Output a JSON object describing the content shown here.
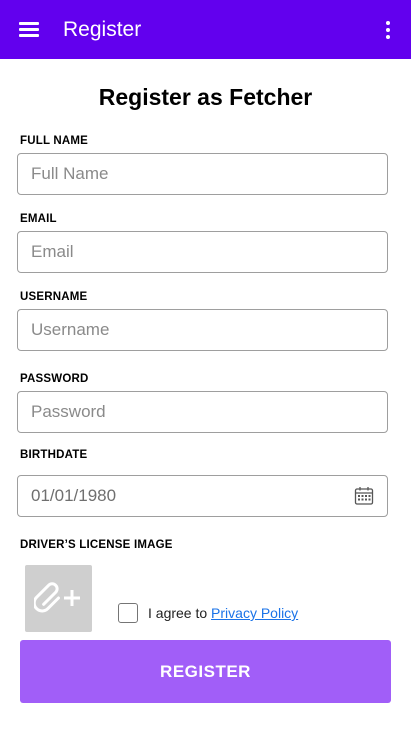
{
  "appbar": {
    "title": "Register",
    "menu_icon": "hamburger-menu-icon",
    "overflow_icon": "more-vert-icon",
    "color": "#6200ee"
  },
  "form": {
    "heading": "Register as Fetcher",
    "full_name": {
      "label": "FULL NAME",
      "placeholder": "Full Name",
      "value": ""
    },
    "email": {
      "label": "EMAIL",
      "placeholder": "Email",
      "value": ""
    },
    "username": {
      "label": "USERNAME",
      "placeholder": "Username",
      "value": ""
    },
    "password": {
      "label": "PASSWORD",
      "placeholder": "Password",
      "value": ""
    },
    "birthdate": {
      "label": "BIRTHDATE",
      "value": "01/01/1980",
      "icon": "calendar-icon"
    },
    "license": {
      "label": "DRIVER’S LICENSE IMAGE",
      "icon": "attach-add-icon"
    },
    "agree": {
      "text": "I agree to",
      "link": "Privacy Policy",
      "checked": false
    },
    "submit_label": "REGISTER",
    "submit_color": "#a15ef8"
  }
}
